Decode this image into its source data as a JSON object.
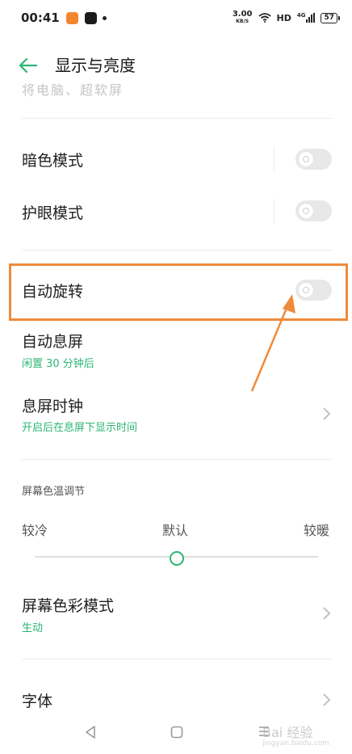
{
  "status_bar": {
    "time": "00:41",
    "speed_value": "3.00",
    "speed_unit": "KB/S",
    "hd": "HD",
    "network": "4G",
    "battery": "57"
  },
  "header": {
    "title": "显示与亮度"
  },
  "faded_text": "将电脑、超软屏",
  "rows": {
    "dark_mode": {
      "label": "暗色模式"
    },
    "eye_care": {
      "label": "护眼模式"
    },
    "auto_rotate": {
      "label": "自动旋转"
    },
    "screen_timeout": {
      "label": "自动息屏",
      "sub": "闲置 30 分钟后"
    },
    "aod_clock": {
      "label": "息屏时钟",
      "sub": "开启后在息屏下显示时间"
    },
    "color_mode": {
      "label": "屏幕色彩模式",
      "sub": "生动"
    },
    "font": {
      "label": "字体"
    }
  },
  "color_temp": {
    "title": "屏幕色温调节",
    "cold": "较冷",
    "default": "默认",
    "warm": "较暖",
    "value": 0.5
  },
  "watermark": {
    "main": "Bai 经验",
    "sub": "jingyan.baidu.com"
  },
  "colors": {
    "accent": "#2bb673",
    "highlight": "#ef8a3a"
  }
}
